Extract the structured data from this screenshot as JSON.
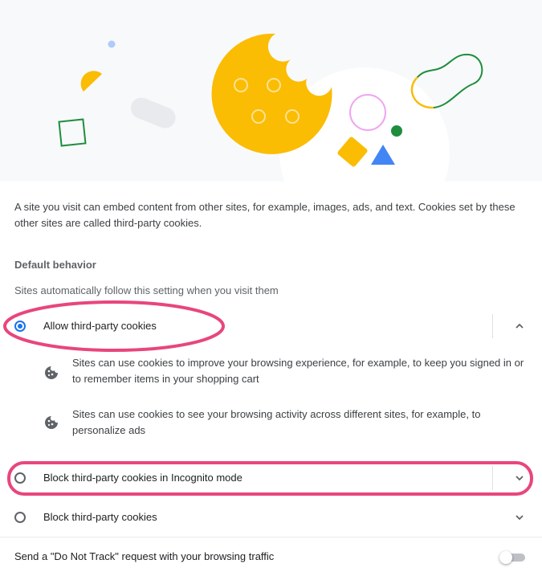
{
  "hero": {
    "illustration": "third-party-cookies-illustration"
  },
  "description": "A site you visit can embed content from other sites, for example, images, ads, and text. Cookies set by these other sites are called third-party cookies.",
  "default_behavior": {
    "title": "Default behavior",
    "subtitle": "Sites automatically follow this setting when you visit them"
  },
  "options": [
    {
      "label": "Allow third-party cookies",
      "selected": true,
      "expanded": true,
      "details": [
        {
          "icon": "cookie-icon",
          "text": "Sites can use cookies to improve your browsing experience, for example, to keep you signed in or to remember items in your shopping cart"
        },
        {
          "icon": "cookie-icon",
          "text": "Sites can use cookies to see your browsing activity across different sites, for example, to personalize ads"
        }
      ]
    },
    {
      "label": "Block third-party cookies in Incognito mode",
      "selected": false,
      "expanded": false
    },
    {
      "label": "Block third-party cookies",
      "selected": false,
      "expanded": false
    }
  ],
  "do_not_track": {
    "label": "Send a \"Do Not Track\" request with your browsing traffic",
    "enabled": false
  },
  "colors": {
    "accent": "#1a73e8",
    "annotation": "#e8467c",
    "cookie": "#fbbc04",
    "green": "#1e8e3e"
  }
}
